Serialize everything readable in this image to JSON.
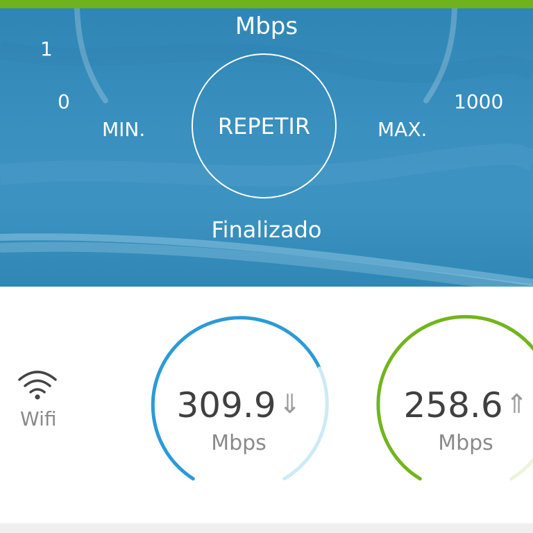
{
  "colors": {
    "top_bar": "#6fb21f",
    "hero_background": "#3a90bf",
    "download_accent": "#2a9bd6",
    "download_track": "#cdeaf6",
    "upload_accent": "#72b51c",
    "upload_track": "#eef3dc"
  },
  "hero": {
    "unit": "Mbps",
    "scale_top": "1",
    "scale_zero": "0",
    "scale_max": "1000",
    "min_label": "MIN.",
    "max_label": "MAX.",
    "repeat_button": "REPETIR",
    "status": "Finalizado"
  },
  "connection": {
    "icon": "wifi-icon",
    "label": "Wifi"
  },
  "download": {
    "value": "309.9",
    "unit": "Mbps",
    "icon": "download-arrow-icon",
    "glyph": "⇓"
  },
  "upload": {
    "value": "258.6",
    "unit": "Mbps",
    "icon": "upload-arrow-icon",
    "glyph": "⇑"
  }
}
